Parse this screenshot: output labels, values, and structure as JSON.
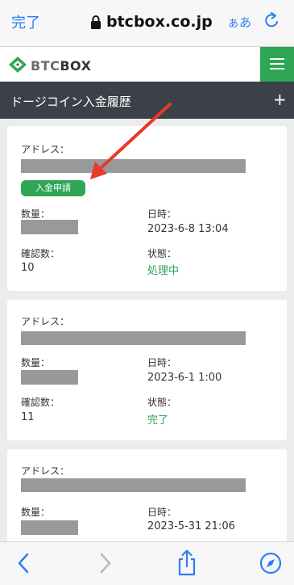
{
  "browser": {
    "done_label": "完了",
    "url": "btcbox.co.jp",
    "text_size_label": "ぁあ"
  },
  "site": {
    "logo_prefix": "BTC",
    "logo_suffix": "BOX",
    "page_title": "ドージコイン入金履歴",
    "add_symbol": "+"
  },
  "labels": {
    "address": "アドレス：",
    "quantity": "数量：",
    "datetime": "日時：",
    "confirmations": "確認数：",
    "status": "状態："
  },
  "badge_label": "入金申請",
  "records": [
    {
      "datetime": "2023-6-8 13:04",
      "confirmations": "10",
      "status": "処理中"
    },
    {
      "datetime": "2023-6-1 1:00",
      "confirmations": "11",
      "status": "完了"
    },
    {
      "datetime": "2023-5-31 21:06",
      "confirmations": "",
      "status": ""
    }
  ],
  "icons": {
    "lock": "lock-icon",
    "reload": "reload-icon",
    "menu": "hamburger-icon",
    "back": "chevron-left-icon",
    "forward": "chevron-right-icon",
    "share": "share-icon",
    "compass": "compass-icon",
    "annotation": "red-arrow"
  },
  "colors": {
    "accent_green": "#2fa655",
    "title_bar": "#3c4149",
    "browser_blue": "#2f7df6",
    "annotation_red": "#e8392b"
  }
}
